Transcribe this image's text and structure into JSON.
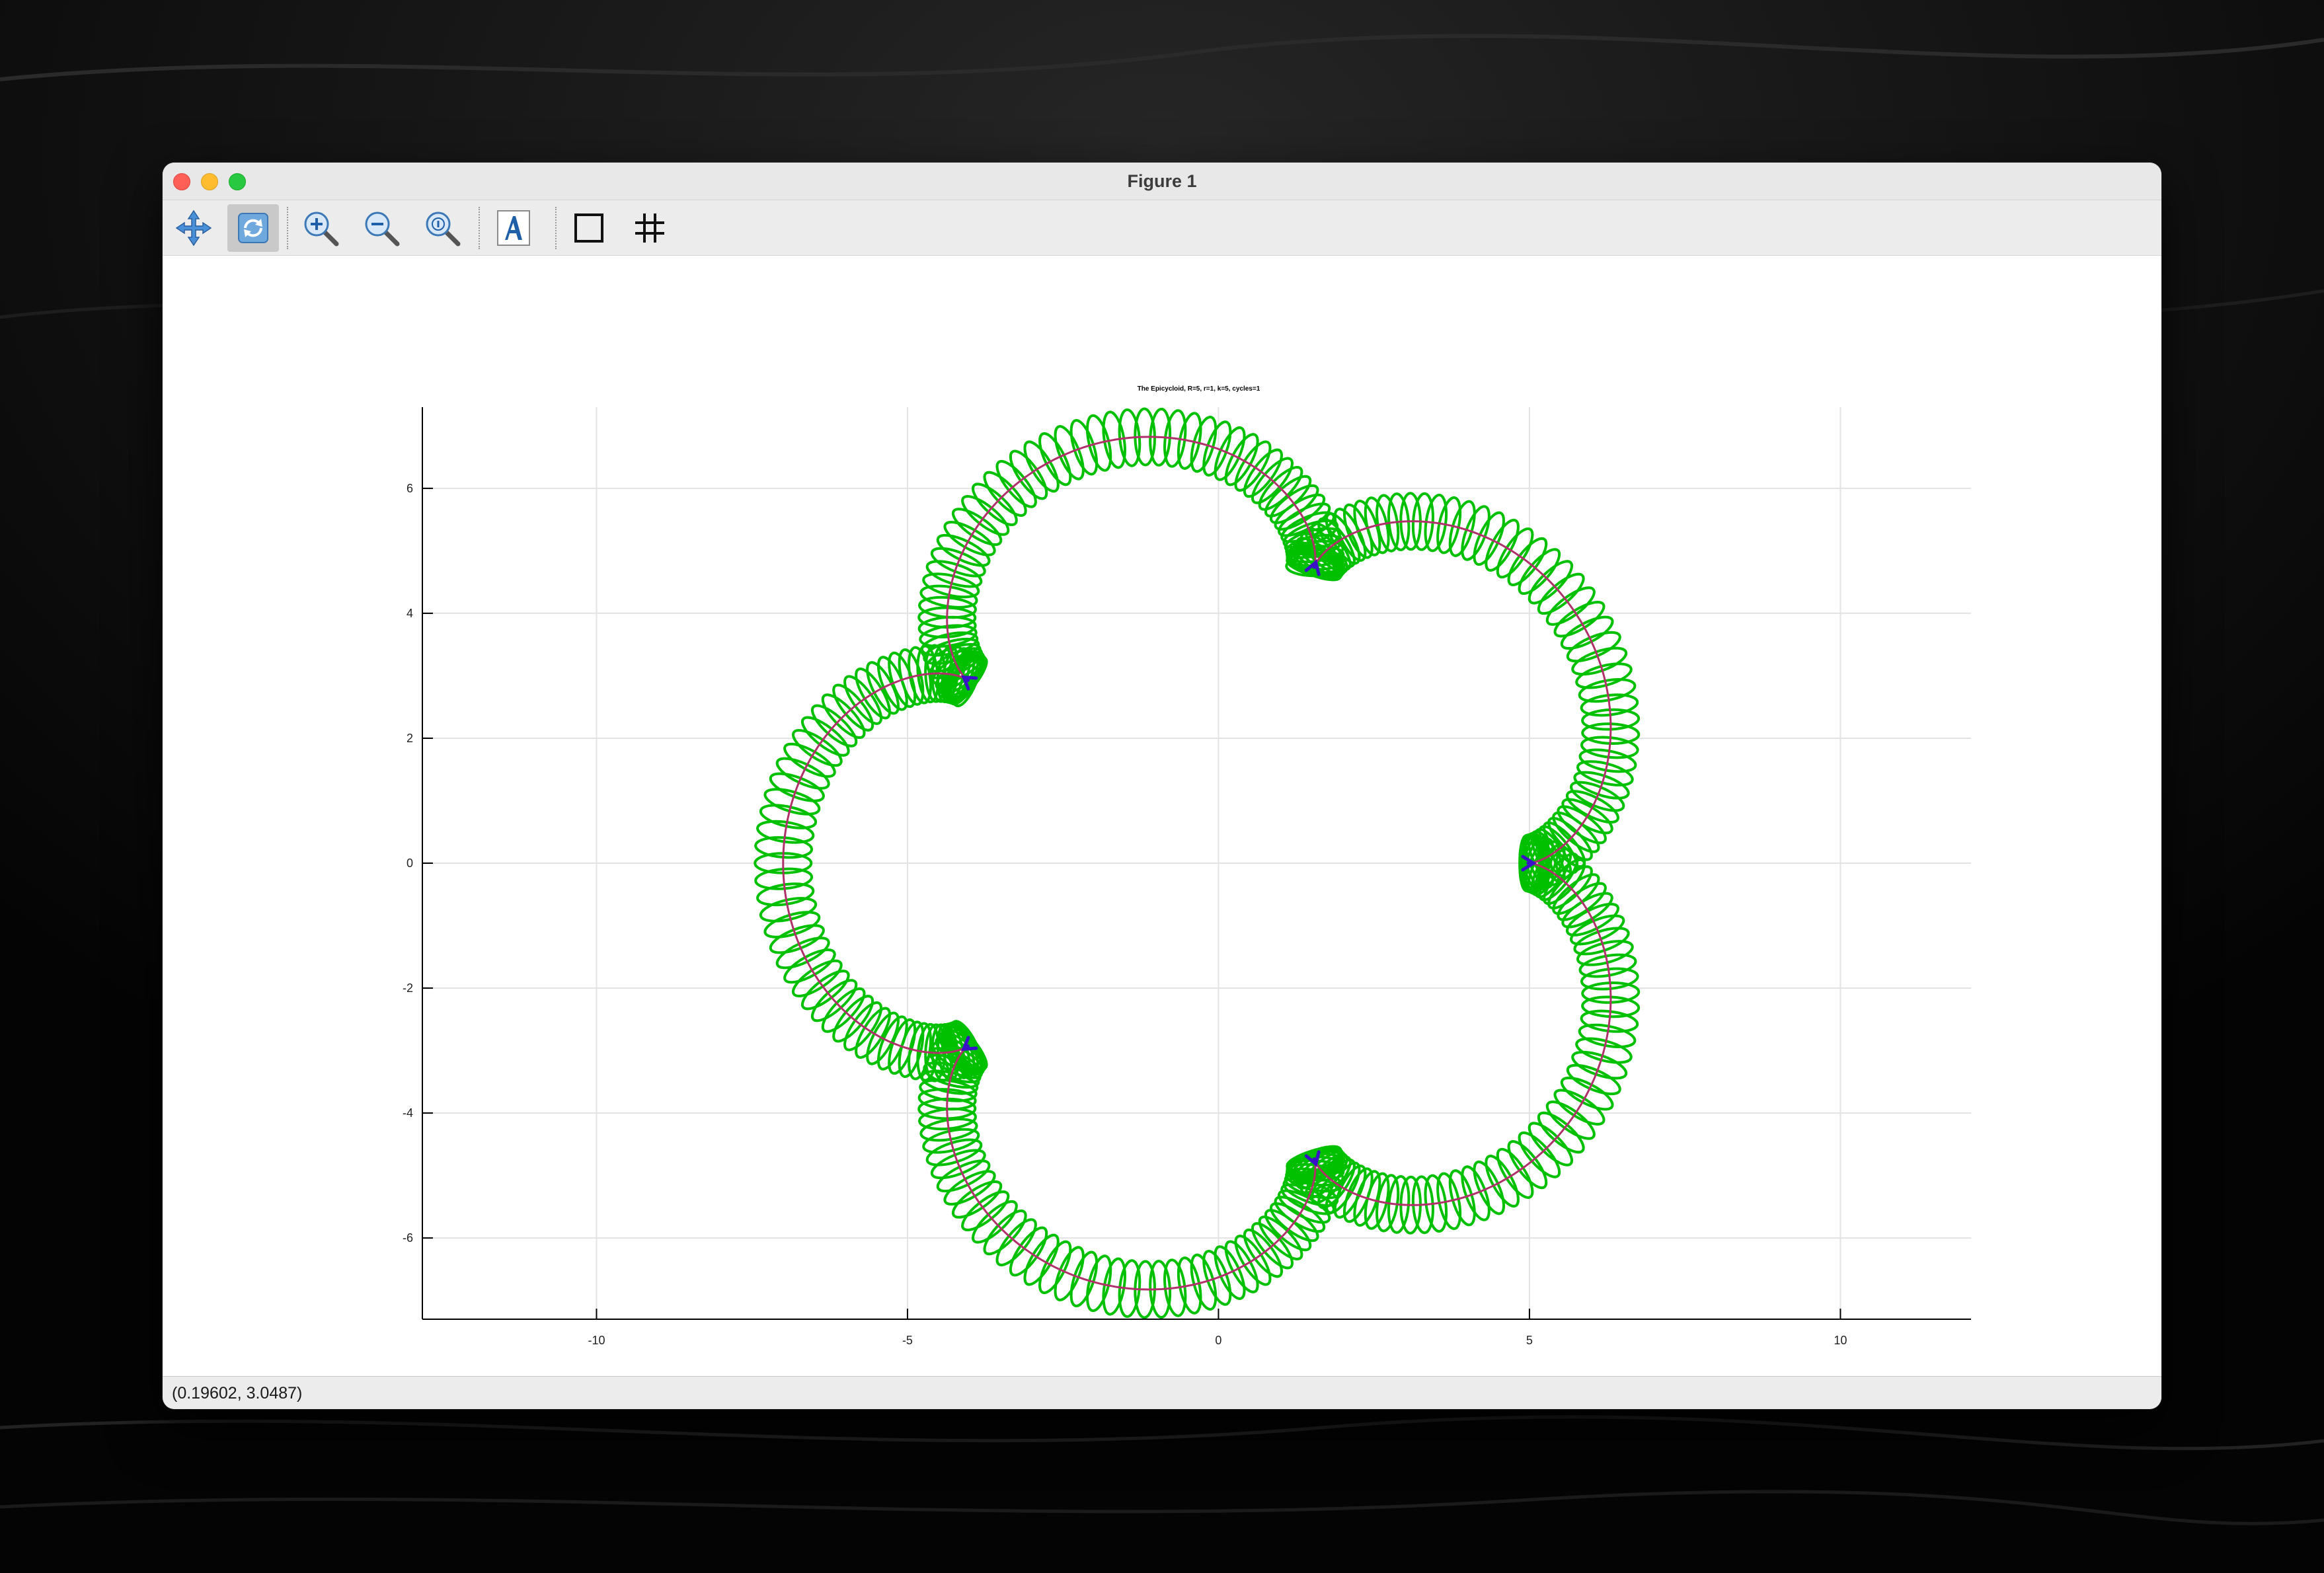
{
  "window": {
    "title": "Figure 1"
  },
  "toolbar": {
    "tools": [
      {
        "name": "pan-tool",
        "icon": "pan-arrows-icon",
        "active": false
      },
      {
        "name": "rotate-tool",
        "icon": "rotate-icon",
        "active": true
      },
      {
        "name": "zoom-in-tool",
        "icon": "zoom-in-icon",
        "active": false
      },
      {
        "name": "zoom-out-tool",
        "icon": "zoom-out-icon",
        "active": false
      },
      {
        "name": "zoom-reset-tool",
        "icon": "zoom-reset-icon",
        "active": false
      },
      {
        "name": "insert-text-tool",
        "icon": "text-a-icon",
        "active": false
      },
      {
        "name": "toggle-box-tool",
        "icon": "square-box-icon",
        "active": false
      },
      {
        "name": "toggle-grid-tool",
        "icon": "grid-icon",
        "active": false
      }
    ]
  },
  "status": {
    "coordinates": "(0.19602, 3.0487)"
  },
  "colors": {
    "loops": "#00c000",
    "guide": "#b0306a",
    "cusp_marker": "#3a10c8",
    "grid": "#e3e3e3",
    "axis": "#000000"
  },
  "chart_data": {
    "type": "line",
    "title": "The Epicycloid, R=5, r=1, k=5, cycles=1",
    "xlabel": "",
    "ylabel": "",
    "xlim": [
      -12.8,
      12.1
    ],
    "ylim": [
      -7.3,
      7.3
    ],
    "xticks": [
      -10,
      -5,
      0,
      5,
      10
    ],
    "yticks": [
      -6,
      -4,
      -2,
      0,
      2,
      4,
      6
    ],
    "grid": true,
    "epicycloid": {
      "R": 5,
      "r": 1,
      "k": 5,
      "cusps": 5,
      "loops": 300,
      "loop_radius": 0.45
    }
  }
}
